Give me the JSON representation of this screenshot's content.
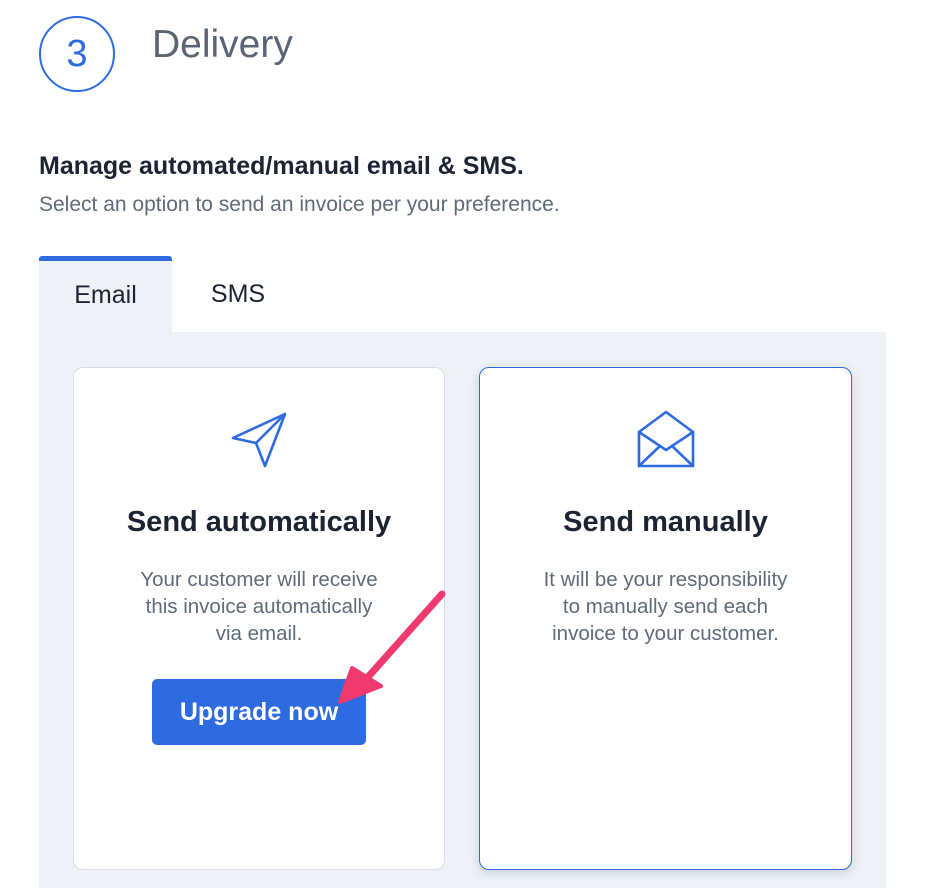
{
  "step": {
    "number": "3",
    "title": "Delivery"
  },
  "section": {
    "heading": "Manage automated/manual email & SMS.",
    "subheading": "Select an option to send an invoice per your preference."
  },
  "tabs": [
    {
      "label": "Email",
      "active": true
    },
    {
      "label": "SMS",
      "active": false
    }
  ],
  "cards": {
    "automatic": {
      "icon": "paper-plane-icon",
      "title": "Send automatically",
      "description": "Your customer will receive\nthis invoice automatically\nvia email.",
      "button_label": "Upgrade now"
    },
    "manual": {
      "icon": "envelope-open-icon",
      "title": "Send manually",
      "description": "It will be your responsibility\nto manually send each\ninvoice to your customer.",
      "selected": true
    }
  },
  "colors": {
    "accent": "#2f6be0",
    "panel_background": "#eef2f7",
    "annotation_arrow": "#f03a6f"
  }
}
